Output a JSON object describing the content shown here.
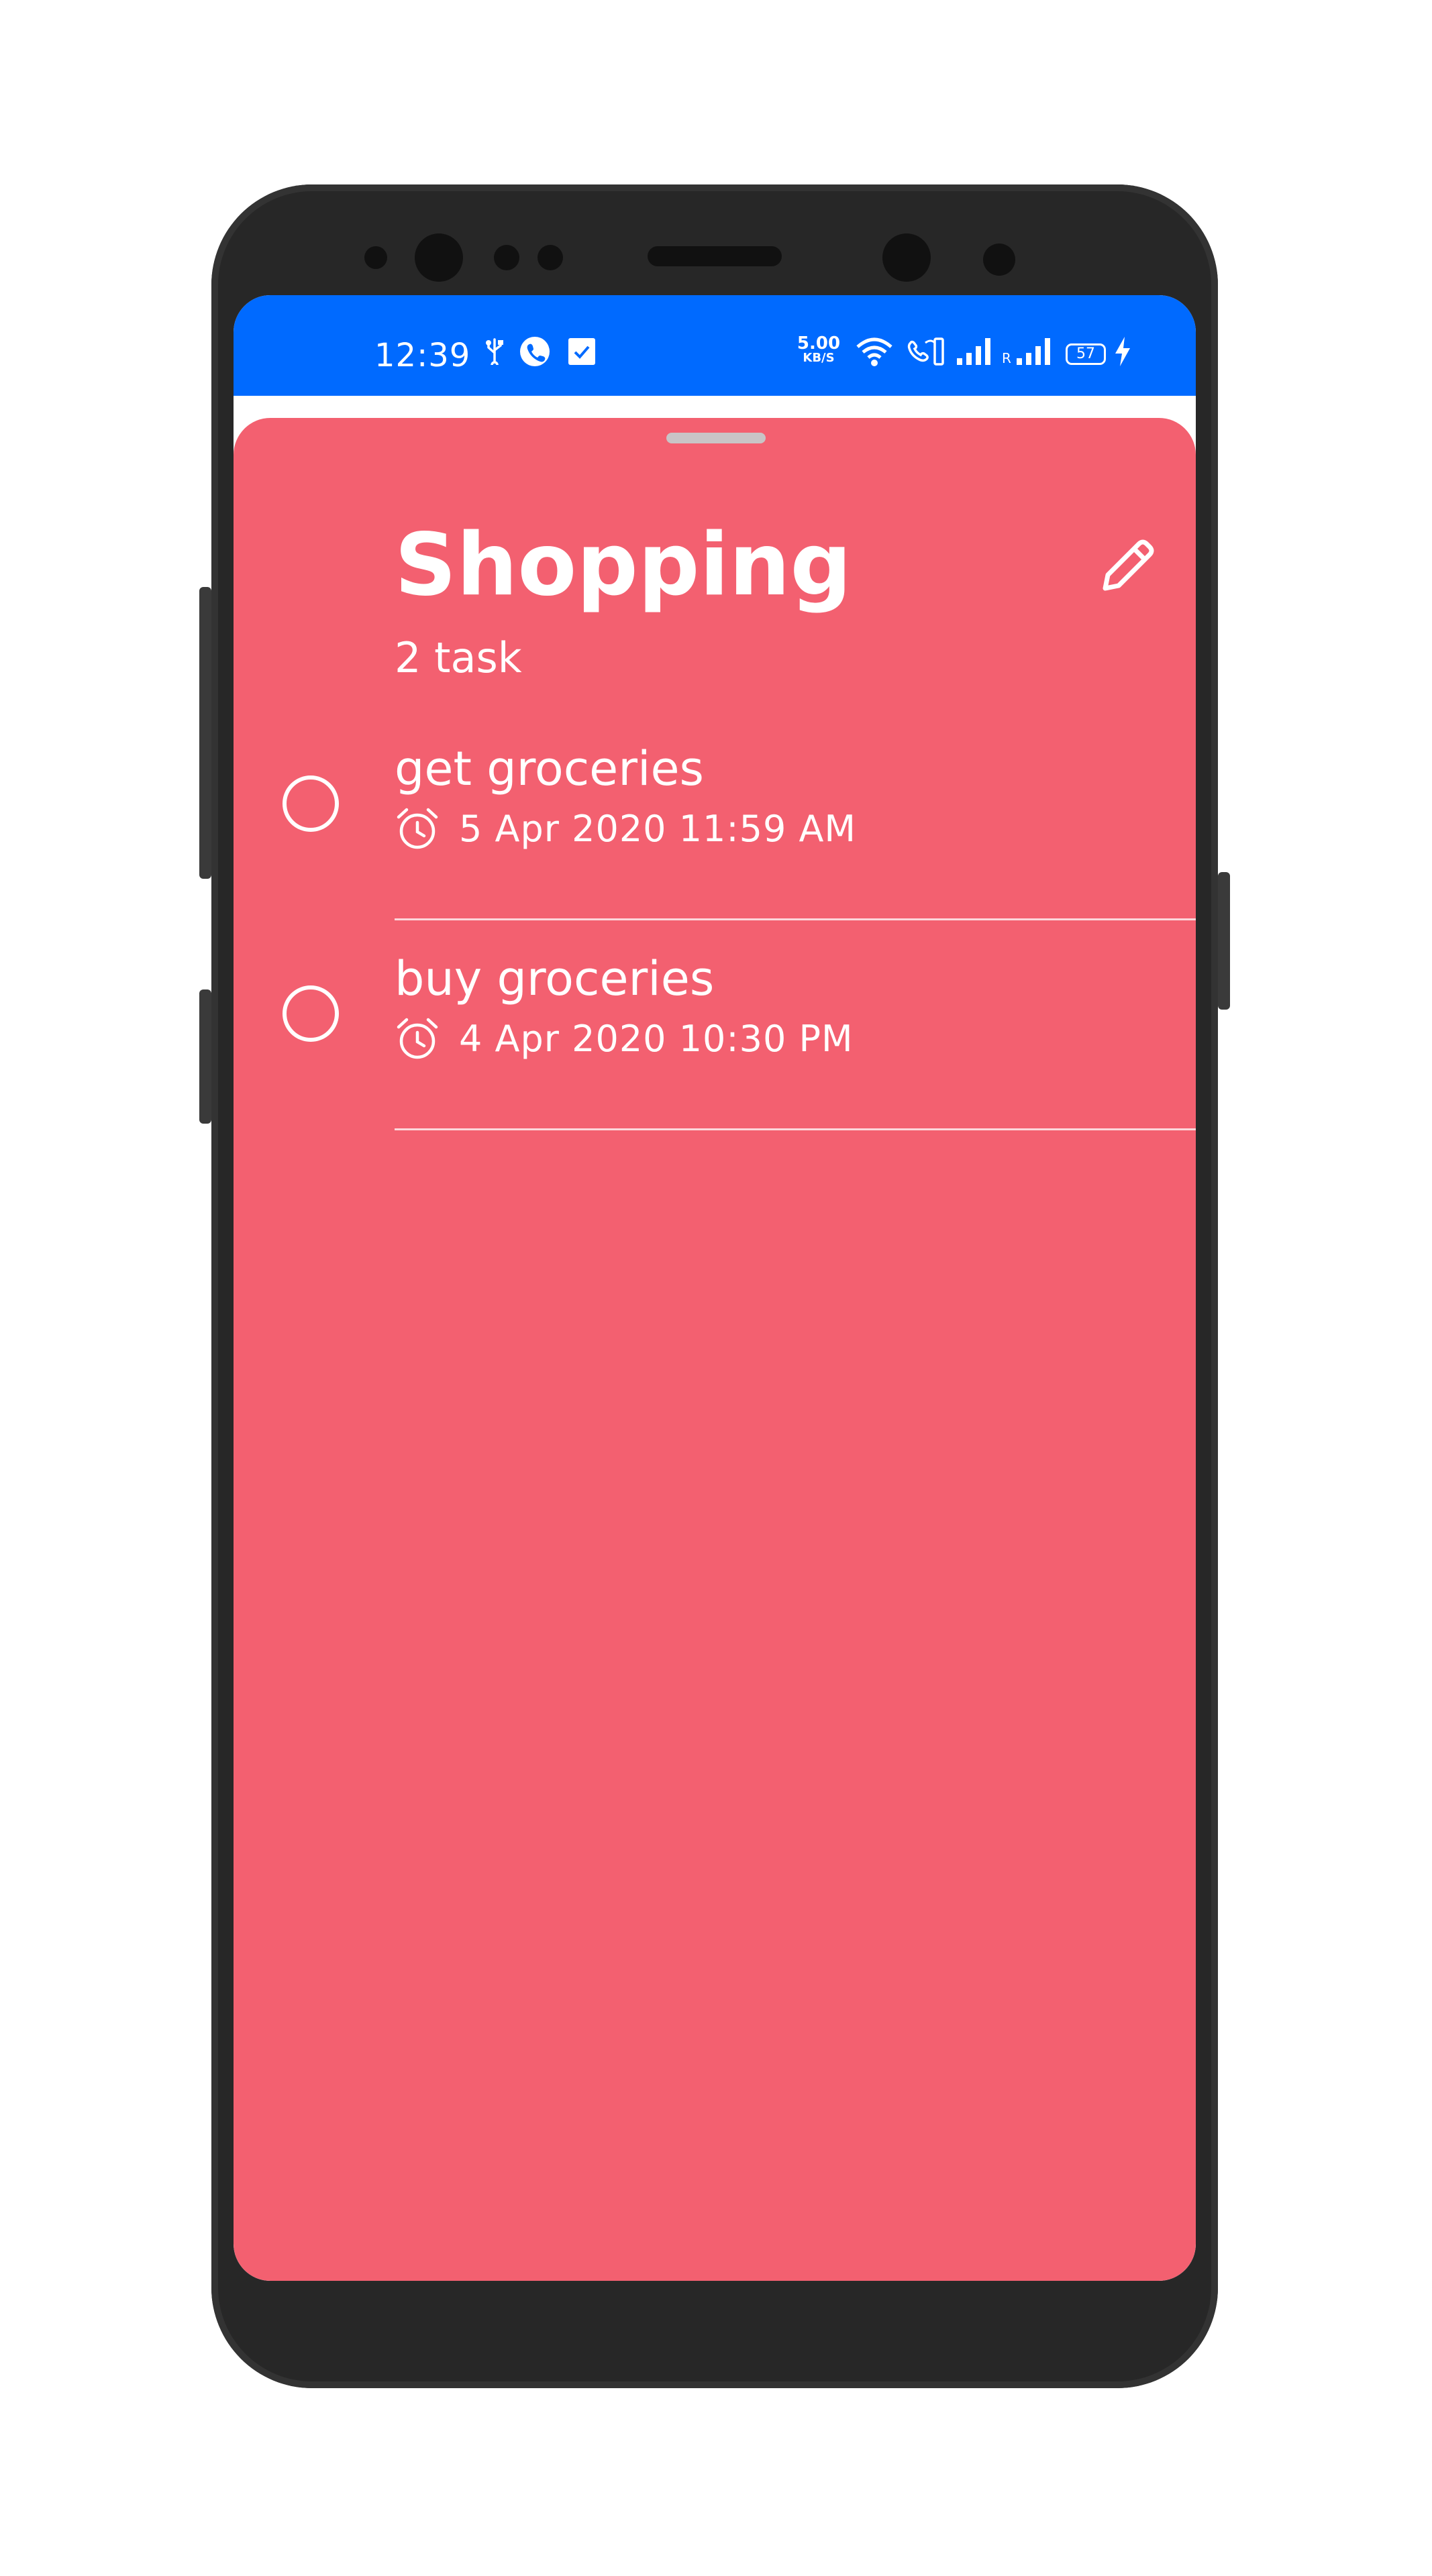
{
  "status_bar": {
    "time": "12:39",
    "network_speed": "5.00",
    "network_speed_unit": "KB/S",
    "battery": "57",
    "roaming_label": "R",
    "icons": [
      "usb-icon",
      "phone-call-icon",
      "checkbox-notification-icon",
      "wifi-icon",
      "wifi-calling-icon",
      "signal-icon",
      "signal-roaming-icon",
      "battery-icon",
      "charging-icon"
    ],
    "background_color": "#006AFF"
  },
  "sheet": {
    "background_color": "#F36070",
    "title": "Shopping",
    "task_count": "2 task",
    "tasks": [
      {
        "title": "get groceries",
        "due": "5 Apr 2020 11:59 AM",
        "done": false
      },
      {
        "title": "buy groceries",
        "due": "4 Apr 2020 10:30 PM",
        "done": false
      }
    ]
  }
}
